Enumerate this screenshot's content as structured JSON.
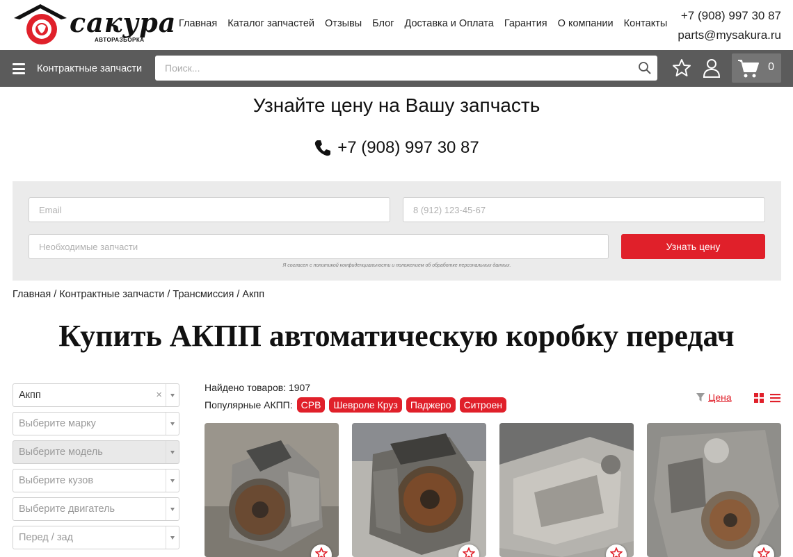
{
  "header": {
    "logo_text": "сакура",
    "logo_sub": "АВТОРАЗБОРКА",
    "nav": [
      "Главная",
      "Каталог запчастей",
      "Отзывы",
      "Блог",
      "Доставка и Оплата",
      "Гарантия",
      "О компании",
      "Контакты"
    ],
    "phone": "+7 (908) 997 30 87",
    "email": "parts@mysakura.ru"
  },
  "toolbar": {
    "menu_label": "Контрактные запчасти",
    "search_placeholder": "Поиск...",
    "cart_count": "0"
  },
  "price_request": {
    "title": "Узнайте цену на Вашу запчасть",
    "phone": "+7 (908) 997 30 87",
    "email_placeholder": "Email",
    "phone_placeholder": "8 (912) 123-45-67",
    "parts_placeholder": "Необходимые запчасти",
    "submit_label": "Узнать цену",
    "consent": "Я согласен с политикой конфиденциальности и положением об обработке персональных данных."
  },
  "breadcrumb": [
    "Главная",
    "Контрактные запчасти",
    "Трансмиссия",
    "Акпп"
  ],
  "page_title": "Купить АКПП автоматическую коробку передач",
  "filters": [
    {
      "value": "Акпп",
      "filled": true,
      "clear": "×"
    },
    {
      "value": "Выберите марку"
    },
    {
      "value": "Выберите модель",
      "disabled": true
    },
    {
      "value": "Выберите кузов"
    },
    {
      "value": "Выберите двигатель"
    },
    {
      "value": "Перед / зад"
    }
  ],
  "results": {
    "found": "Найдено товаров: 1907",
    "popular_label": "Популярные АКПП:",
    "tags": [
      "CPB",
      "Шевроле Круз",
      "Паджеро",
      "Ситроен"
    ],
    "sort_label": "Цена"
  },
  "colors": {
    "accent": "#e0202a",
    "bar": "#5b5b5b",
    "form_bg": "#ebebeb"
  }
}
